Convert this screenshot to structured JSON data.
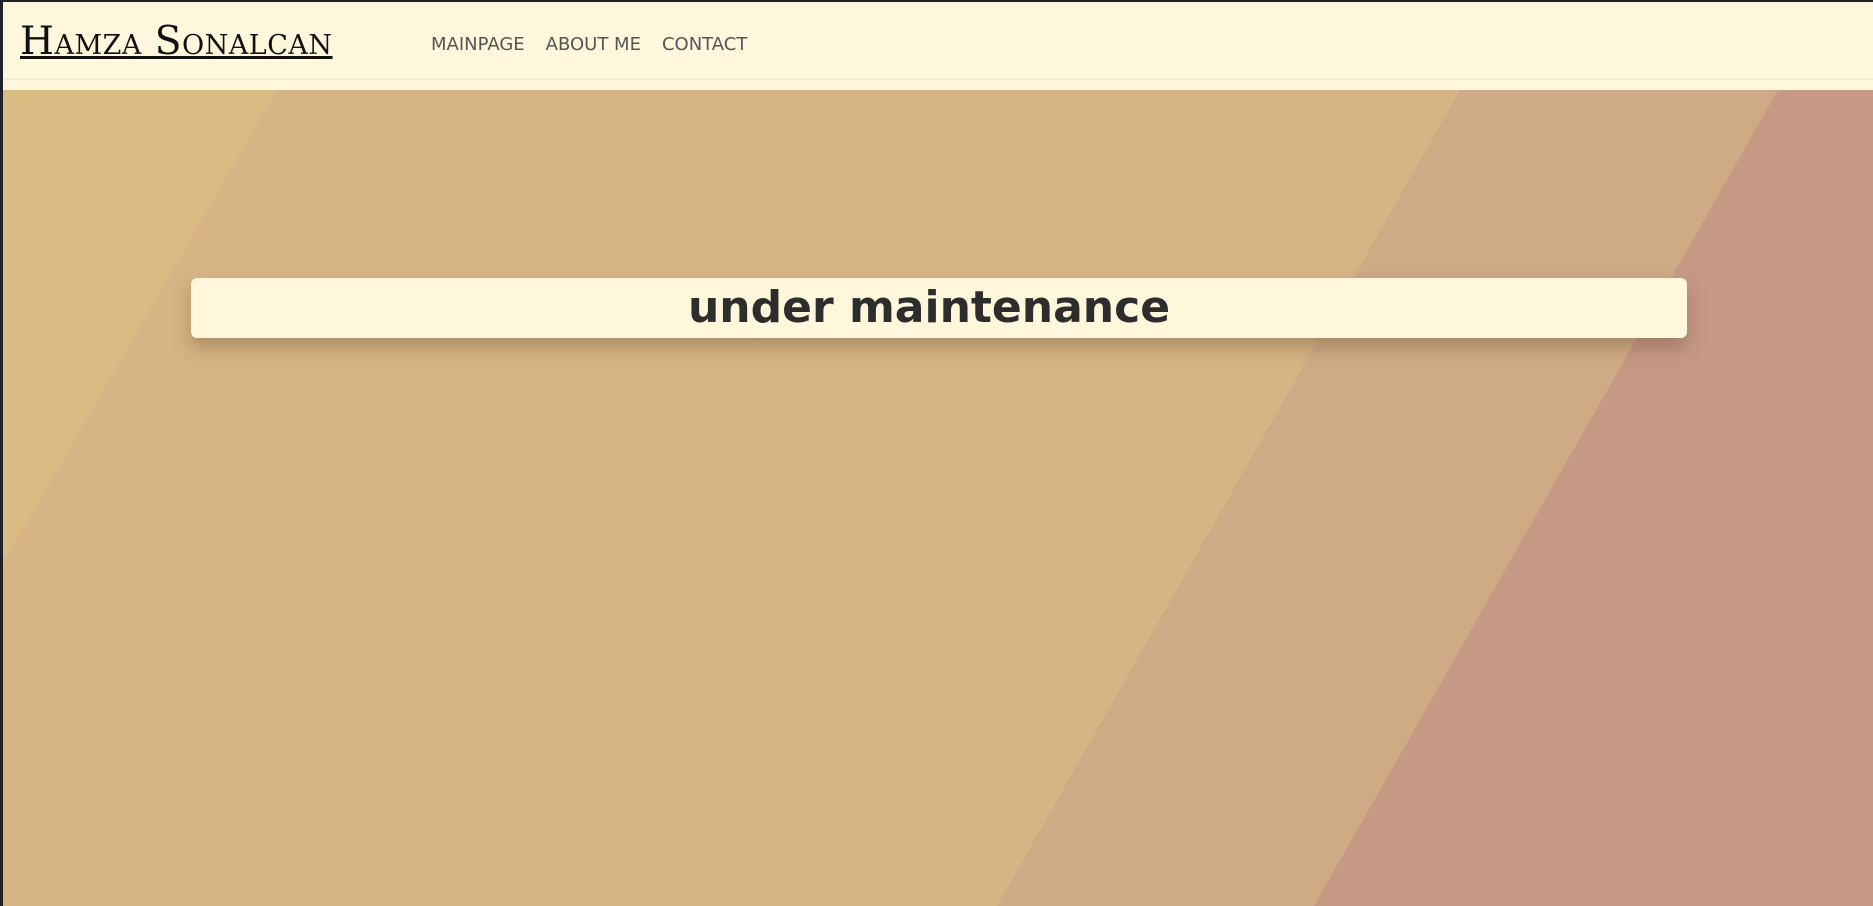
{
  "navbar": {
    "brand": "Hamza Sonalcan",
    "links": [
      {
        "label": "MAINPAGE"
      },
      {
        "label": "ABOUT ME"
      },
      {
        "label": "CONTACT"
      }
    ]
  },
  "hero": {
    "message": "under maintenance"
  },
  "colors": {
    "navbar_background": "#fff7dc",
    "hero_main": "#d6b485",
    "hero_left_band": "#d9bc84",
    "hero_right_band_1": "#cfab85",
    "hero_right_band_2": "#c69985",
    "text_dark": "#2d2d2d",
    "nav_text": "#555555"
  }
}
